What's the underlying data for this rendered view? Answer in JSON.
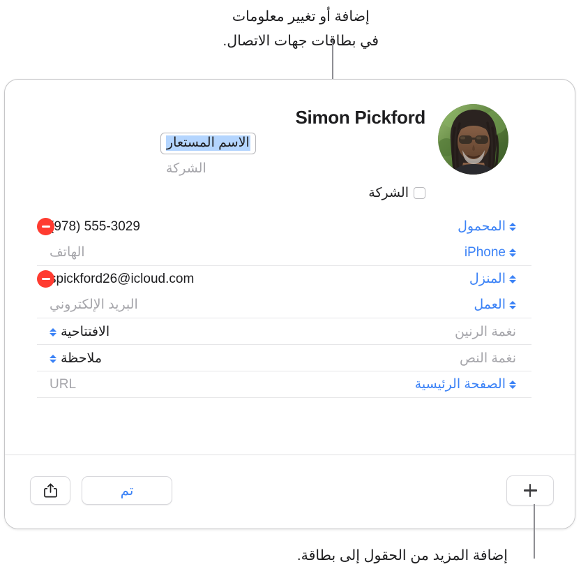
{
  "captions": {
    "top": "إضافة أو تغيير معلومات\nفي بطاقات جهات الاتصال.",
    "bottom": "إضافة المزيد من الحقول إلى بطاقة."
  },
  "card": {
    "identity": {
      "first_name": "Simon",
      "last_name": "Pickford",
      "full_name": "Simon Pickford",
      "nickname_placeholder": "الاسم المستعار",
      "company_placeholder": "الشركة",
      "company_checkbox_label": "الشركة",
      "company_checked": false,
      "avatar_alt": "avatar-photo"
    },
    "fields": [
      {
        "id": "phone-mobile",
        "label": "المحمول",
        "label_color": "#3b82f6",
        "value": "(978) 555-3029",
        "value_is_placeholder": false,
        "has_remove": true,
        "has_stepper": true
      },
      {
        "id": "phone-iphone",
        "label": "iPhone",
        "label_color": "#3b82f6",
        "value": "الهاتف",
        "value_is_placeholder": true,
        "has_remove": false,
        "has_stepper": true
      },
      {
        "id": "email-home",
        "label": "المنزل",
        "label_color": "#3b82f6",
        "value": "spickford26@icloud.com",
        "value_is_placeholder": false,
        "has_remove": true,
        "has_stepper": true
      },
      {
        "id": "email-work",
        "label": "العمل",
        "label_color": "#3b82f6",
        "value": "البريد الإلكتروني",
        "value_is_placeholder": true,
        "has_remove": false,
        "has_stepper": true
      }
    ],
    "tone_fields": [
      {
        "id": "ringtone",
        "left_label": "نغمة الرنين",
        "value": "الافتتاحية",
        "has_stepper": true
      },
      {
        "id": "text-tone",
        "left_label": "نغمة النص",
        "value": "ملاحظة",
        "has_stepper": true
      }
    ],
    "homepage": {
      "id": "homepage",
      "label": "الصفحة الرئيسية",
      "value": "URL",
      "value_is_placeholder": true,
      "has_stepper": true
    },
    "toolbar": {
      "share_icon": "share-icon",
      "done_label": "تم",
      "add_icon": "plus-icon"
    }
  },
  "colors": {
    "accent_blue": "#3b82f6",
    "remove_red": "#ff3b30",
    "placeholder_gray": "#a6a6ab",
    "separator": "#e6e6e8",
    "selection_highlight": "#b4d5fe",
    "text": "#1d1d1f"
  }
}
